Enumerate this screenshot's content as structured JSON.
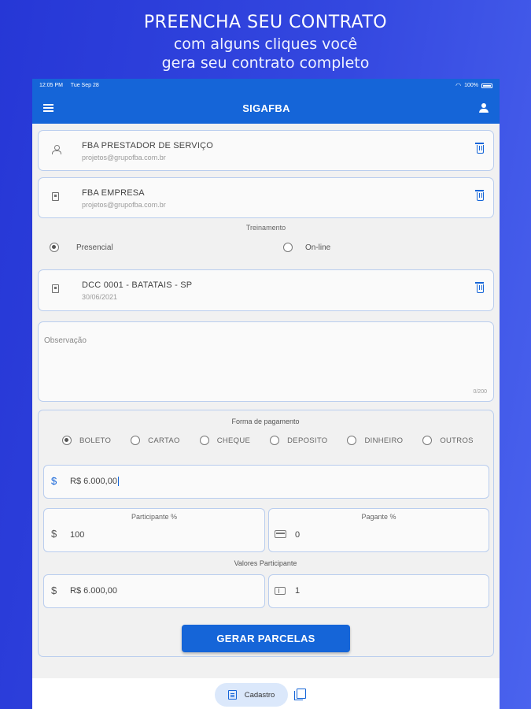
{
  "promo": {
    "title": "PREENCHA SEU CONTRATO",
    "subtitle_line1": "com alguns cliques você",
    "subtitle_line2": "gera seu contrato completo"
  },
  "status_bar": {
    "time": "12:05 PM",
    "date": "Tue Sep 28",
    "battery": "100%"
  },
  "app_bar": {
    "title": "SIGAFBA",
    "menu_icon": "menu-icon",
    "profile_icon": "user-icon"
  },
  "cards": [
    {
      "icon": "person-icon",
      "title": "FBA PRESTADOR DE SERVIÇO",
      "subtitle": "projetos@grupofba.com.br"
    },
    {
      "icon": "building-icon",
      "title": "FBA EMPRESA",
      "subtitle": "projetos@grupofba.com.br"
    },
    {
      "icon": "building-icon",
      "title": "DCC 0001 - BATATAIS - SP",
      "subtitle": "30/06/2021"
    }
  ],
  "training": {
    "label": "Treinamento",
    "options": [
      "Presencial",
      "On-line"
    ],
    "selected": "Presencial"
  },
  "observation": {
    "placeholder": "Observação",
    "counter": "0/200"
  },
  "payment": {
    "label": "Forma de pagamento",
    "options": [
      "BOLETO",
      "CARTAO",
      "CHEQUE",
      "DEPOSITO",
      "DINHEIRO",
      "OUTROS"
    ],
    "selected": "BOLETO",
    "amount": "R$ 6.000,00",
    "participante_label": "Participante %",
    "participante_value": "100",
    "pagante_label": "Pagante %",
    "pagante_value": "0",
    "valores_label": "Valores Participante",
    "valores_value": "R$ 6.000,00",
    "installments": "1",
    "currency_symbol": "$",
    "button": "GERAR PARCELAS"
  },
  "bottom_nav": {
    "active_tab": "Cadastro"
  },
  "colors": {
    "primary": "#1565d8",
    "background_gradient_start": "#2637d6",
    "background_gradient_end": "#4a63ee"
  }
}
